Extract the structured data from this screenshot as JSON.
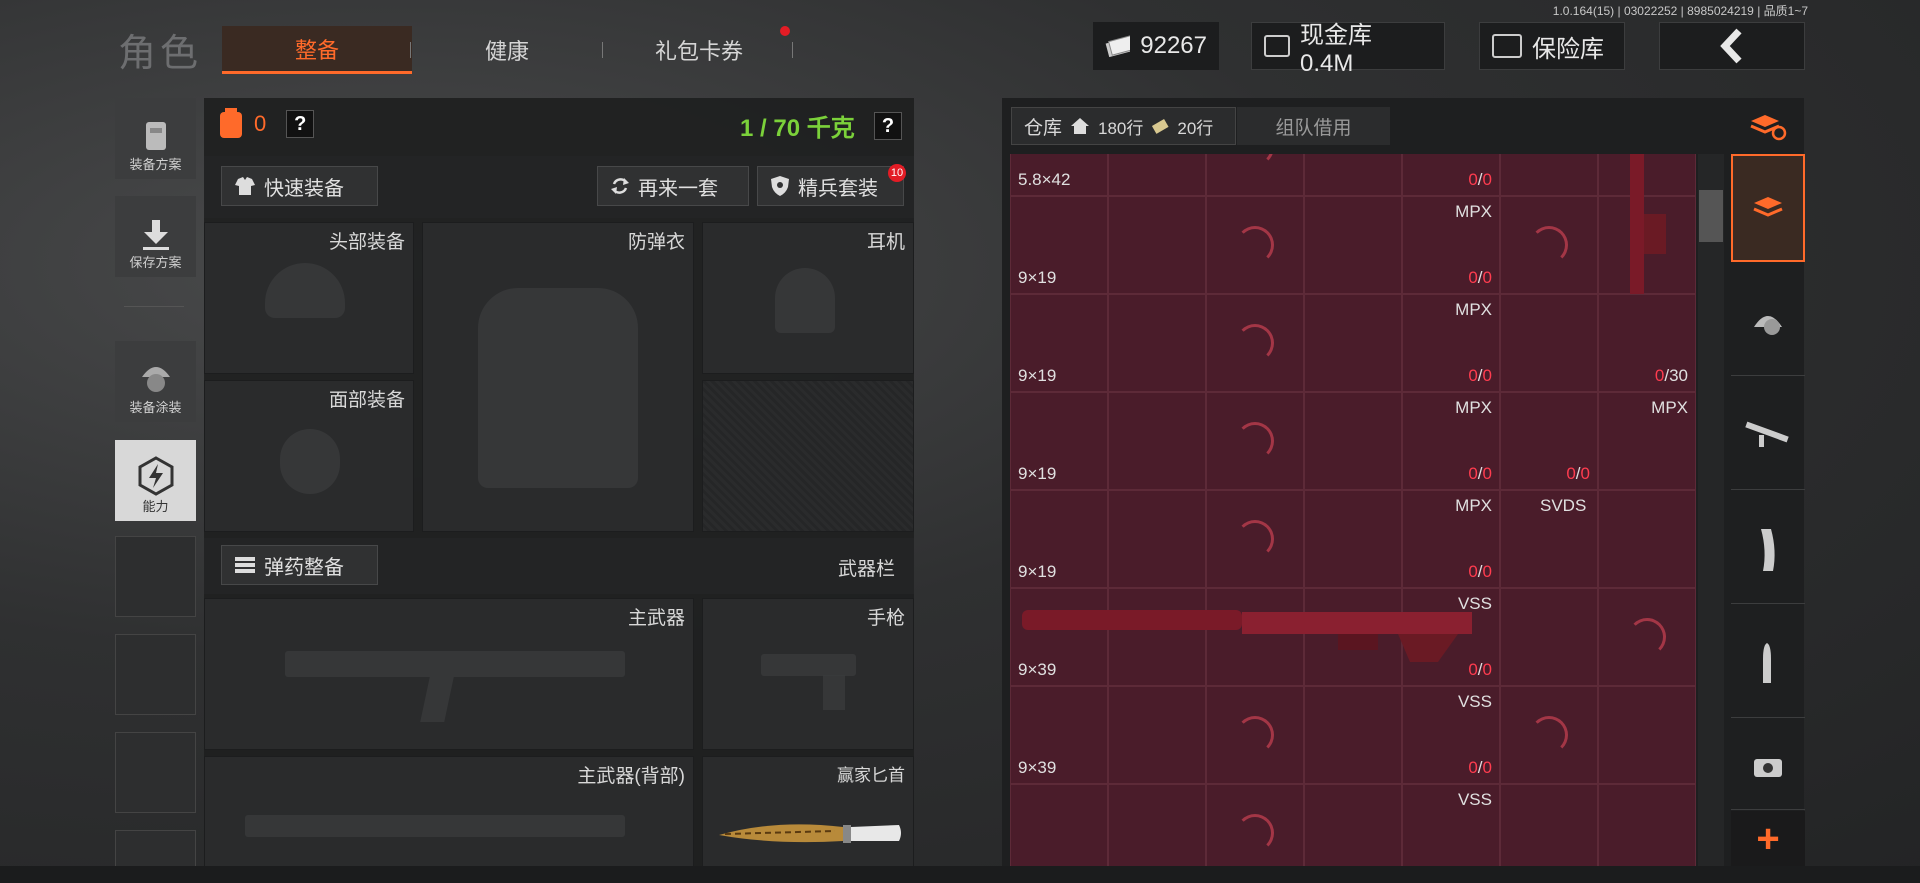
{
  "build_info": "1.0.164(15) | 03022252 | 8985024219 | 品质1~7",
  "header": {
    "title": "角色",
    "tabs": [
      {
        "label": "整备"
      },
      {
        "label": "健康"
      },
      {
        "label": "礼包卡券"
      }
    ],
    "money": "92267",
    "cash_vault": "现金库 0.4M",
    "safe_vault": "保险库",
    "colors": {
      "accent": "#ff6a2a",
      "alert": "#e31c25",
      "ammo_zero": "#ff3c4f",
      "weight_green": "#7bd13a"
    }
  },
  "sidebar": {
    "items": [
      {
        "label": "装备方案"
      },
      {
        "label": "保存方案"
      },
      {
        "label": "装备涂装"
      },
      {
        "label": "能力"
      }
    ]
  },
  "equip": {
    "armor_count": "0",
    "help": "?",
    "weight": "1 / 70 千克",
    "quick_equip": "快速装备",
    "again": "再来一套",
    "elite": "精兵套装",
    "elite_badge": "10",
    "slots": {
      "head": "头部装备",
      "vest": "防弹衣",
      "headset": "耳机",
      "face": "面部装备"
    },
    "ammo_equip": "弹药整备",
    "weapon_bar": "武器栏",
    "weapons": {
      "primary": "主武器",
      "pistol": "手枪",
      "primary_back": "主武器(背部)",
      "melee": "赢家匕首"
    }
  },
  "storage": {
    "tab_label": "仓库",
    "rows_a": "180行",
    "rows_b": "20行",
    "team_borrow": "组队借用",
    "cells": [
      {
        "caliber": "5.8×42",
        "ammo_a": "0",
        "ammo_b": "0"
      },
      {
        "name": "MPX",
        "caliber": "9×19",
        "ammo_a": "0",
        "ammo_b": "0"
      },
      {
        "name": "MPX",
        "caliber": "9×19",
        "ammo_a": "0",
        "ammo_b": "0"
      },
      {
        "name": "MPX",
        "caliber": "9×19",
        "ammo_a": "0",
        "ammo_b": "0"
      },
      {
        "name": "MPX",
        "caliber": "9×19",
        "ammo_a": "0",
        "ammo_b": "0"
      },
      {
        "name": "VSS",
        "caliber": "9×39",
        "ammo_a": "0",
        "ammo_b": "0"
      },
      {
        "name": "VSS",
        "caliber": "9×39",
        "ammo_a": "0",
        "ammo_b": "0"
      },
      {
        "name": "VSS",
        "caliber": "",
        "ammo_a": "",
        "ammo_b": ""
      }
    ],
    "col6": [
      {
        "ammo_a": "0",
        "ammo_b": "30"
      },
      {
        "name": "MPX"
      }
    ],
    "col5": [
      {
        "ammo_a": "0",
        "ammo_b": "0"
      },
      {
        "name": "SVDS"
      }
    ]
  },
  "slash": "/",
  "right_tools": {
    "add": "+"
  }
}
